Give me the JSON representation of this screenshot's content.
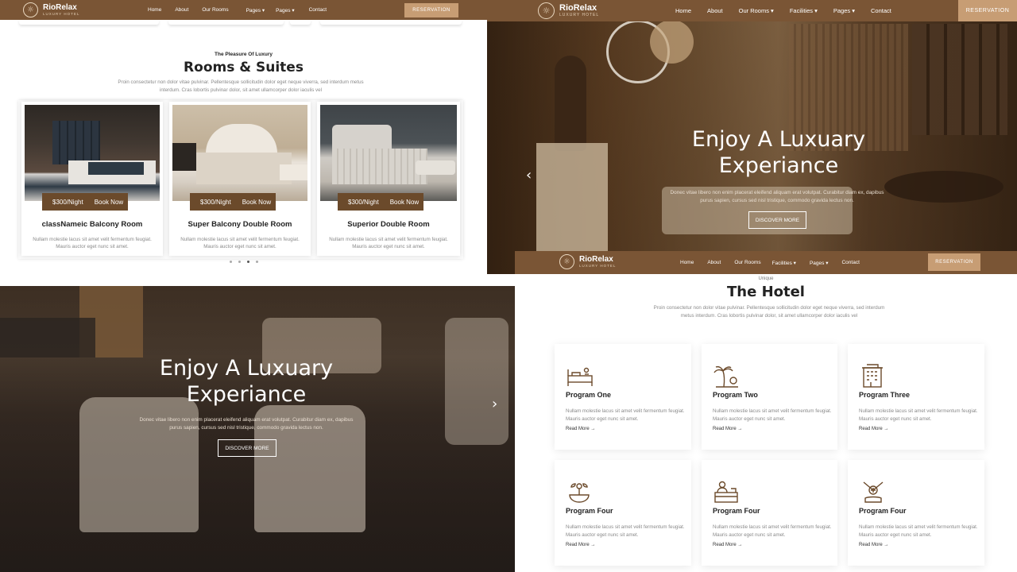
{
  "brand": {
    "name": "RioRelax",
    "tagline": "LUXURY HOTEL",
    "logo_icon": "swirl-logo-icon"
  },
  "nav_top_left": {
    "items": [
      "Home",
      "About",
      "Our Rooms",
      "Pages",
      "Pages",
      "Contact"
    ],
    "reservation": "RESERVATION"
  },
  "nav_top_right": {
    "items": [
      "Home",
      "About",
      "Our Rooms",
      "Facilities",
      "Pages",
      "Contact"
    ],
    "reservation": "RESERVATION"
  },
  "nav_mid_right": {
    "items": [
      "Home",
      "About",
      "Our Rooms",
      "Facilities",
      "Pages",
      "Contact"
    ],
    "reservation": "RESERVATION"
  },
  "rooms": {
    "kicker": "The Pleasure Of Luxury",
    "title": "Rooms & Suites",
    "text": "Proin consectetur non dolor vitae pulvinar. Pellentesque sollicitudin dolor eget neque viverra, sed interdum metus interdum. Cras lobortis pulvinar dolor, sit amet ullamcorper dolor iaculis vel",
    "cards": [
      {
        "price": "$300/Night",
        "book": "Book Now",
        "name": "classNameic Balcony Room",
        "desc": "Nullam molestie lacus sit amet velit fermentum feugiat. Mauris auctor eget nunc sit amet."
      },
      {
        "price": "$300/Night",
        "book": "Book Now",
        "name": "Super Balcony Double Room",
        "desc": "Nullam molestie lacus sit amet velit fermentum feugiat. Mauris auctor eget nunc sit amet."
      },
      {
        "price": "$300/Night",
        "book": "Book Now",
        "name": "Superior Double Room",
        "desc": "Nullam molestie lacus sit amet velit fermentum feugiat. Mauris auctor eget nunc sit amet."
      }
    ]
  },
  "hero_right": {
    "title_line1": "Enjoy A Luxuary",
    "title_line2": "Experiance",
    "text": "Donec vitae libero non enim placerat eleifend aliquam erat volutpat. Curabitur diam ex, dapibus purus sapien, cursus sed nisl tristique, commodo gravida lectus non.",
    "button": "DISCOVER MORE",
    "prev_arrow": "‹"
  },
  "hero_left": {
    "title_line1": "Enjoy A Luxuary",
    "title_line2": "Experiance",
    "text": "Donec vitae libero non enim placerat eleifend aliquam erat volutpat. Curabitur diam ex, dapibus purus sapien, cursus sed nisl tristique, commodo gravida lectus non.",
    "button": "DISCOVER MORE",
    "next_arrow": "›"
  },
  "hotel": {
    "kicker": "Unique",
    "title": "The Hotel",
    "text": "Proin consectetur non dolor vitae pulvinar. Pellentesque sollicitudin dolor eget neque viverra, sed interdum metus interdum. Cras lobortis pulvinar dolor, sit amet ullamcorper dolor iaculis vel",
    "cards": [
      {
        "icon": "bed-icon",
        "title": "Program One",
        "desc": "Nullam molestie lacus sit amet velit fermentum feugiat. Mauris auctor eget nunc sit amet.",
        "link": "Read More →"
      },
      {
        "icon": "palm-tree-icon",
        "title": "Program Two",
        "desc": "Nullam molestie lacus sit amet velit fermentum feugiat. Mauris auctor eget nunc sit amet.",
        "link": "Read More →"
      },
      {
        "icon": "building-icon",
        "title": "Program Three",
        "desc": "Nullam molestie lacus sit amet velit fermentum feugiat. Mauris auctor eget nunc sit amet.",
        "link": "Read More →"
      },
      {
        "icon": "spa-bowl-icon",
        "title": "Program Four",
        "desc": "Nullam molestie lacus sit amet velit fermentum feugiat. Mauris auctor eget nunc sit amet.",
        "link": "Read More →"
      },
      {
        "icon": "reception-desk-icon",
        "title": "Program Four",
        "desc": "Nullam molestie lacus sit amet velit fermentum feugiat. Mauris auctor eget nunc sit amet.",
        "link": "Read More →"
      },
      {
        "icon": "massage-icon",
        "title": "Program Four",
        "desc": "Nullam molestie lacus sit amet velit fermentum feugiat. Mauris auctor eget nunc sit amet.",
        "link": "Read More →"
      }
    ]
  },
  "colors": {
    "brand_brown": "#7a5535",
    "reservation_tan": "#c79d74",
    "price_bar": "#6b4a2b"
  }
}
